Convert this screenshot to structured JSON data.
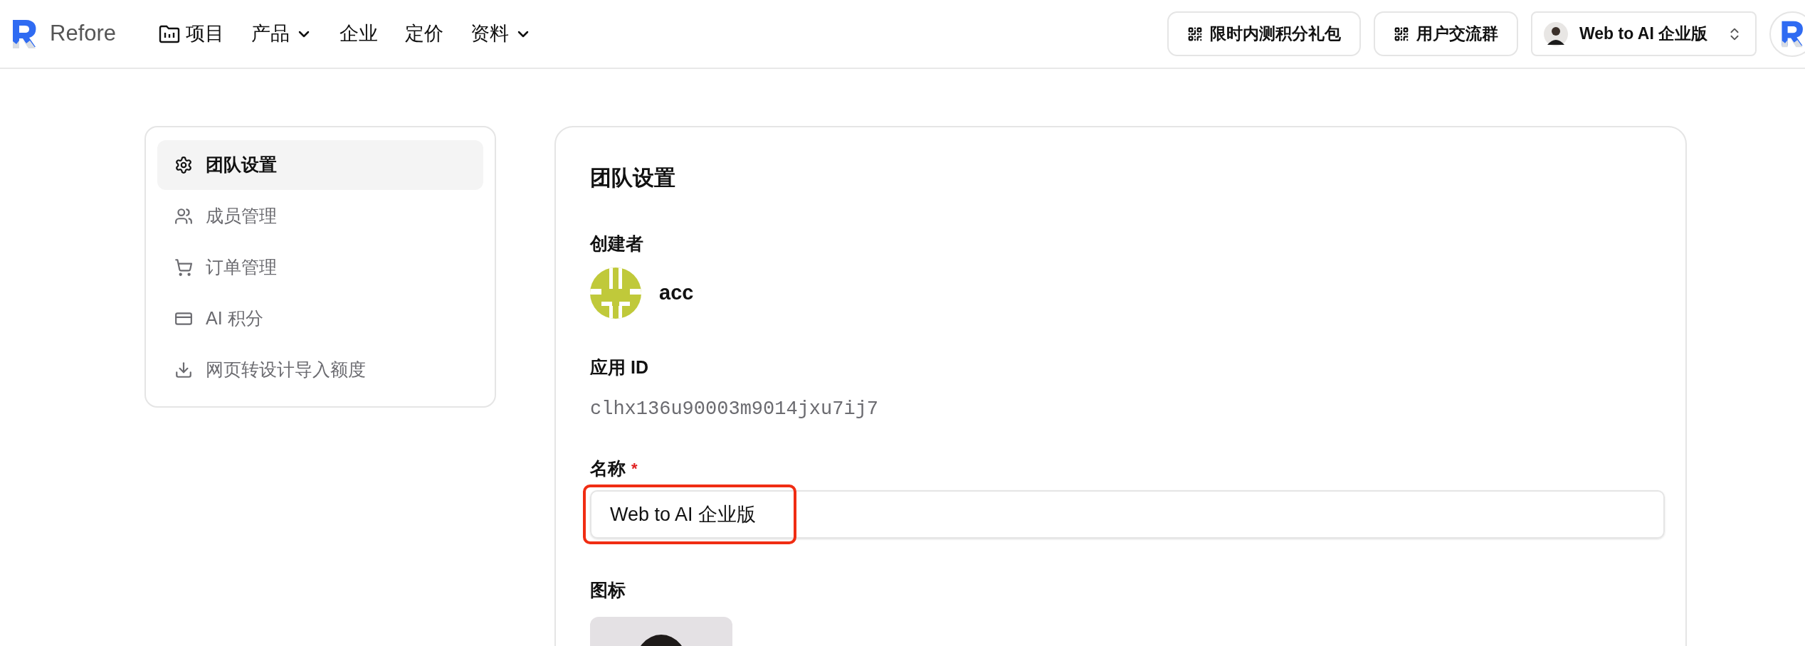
{
  "brand": {
    "name": "Refore"
  },
  "nav": [
    {
      "label": "项目",
      "kind": "folder"
    },
    {
      "label": "产品",
      "kind": "dropdown"
    },
    {
      "label": "企业",
      "kind": "plain"
    },
    {
      "label": "定价",
      "kind": "plain"
    },
    {
      "label": "资料",
      "kind": "dropdown"
    }
  ],
  "header_buttons": [
    {
      "label": "限时内测积分礼包"
    },
    {
      "label": "用户交流群"
    }
  ],
  "team_switcher": {
    "label": "Web to AI 企业版"
  },
  "sidebar": {
    "items": [
      {
        "label": "团队设置",
        "kind": "gear",
        "selected": true
      },
      {
        "label": "成员管理",
        "kind": "users",
        "selected": false
      },
      {
        "label": "订单管理",
        "kind": "cart",
        "selected": false
      },
      {
        "label": "AI 积分",
        "kind": "card",
        "selected": false
      },
      {
        "label": "网页转设计导入额度",
        "kind": "download",
        "selected": false
      }
    ]
  },
  "panel": {
    "title": "团队设置",
    "creator": {
      "label": "创建者",
      "name": "acc"
    },
    "app_id": {
      "label": "应用 ID",
      "value": "clhx136u90003m9014jxu7ij7"
    },
    "name_field": {
      "label": "名称",
      "required_mark": "*",
      "value": "Web to AI 企业版",
      "highlighted": true
    },
    "icon_field": {
      "label": "图标",
      "kind": "picture"
    }
  }
}
